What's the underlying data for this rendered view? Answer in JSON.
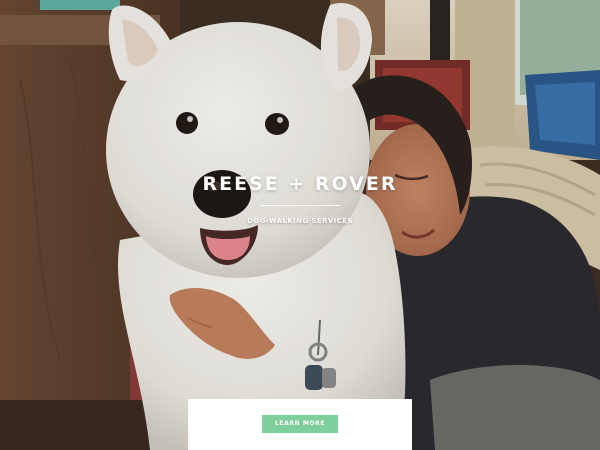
{
  "hero": {
    "title": "REESE + ROVER",
    "subtitle": "DOG-WALKING SERVICES",
    "photo_icon": "hero-photo-dog-and-owner"
  },
  "cta": {
    "label": "LEARN MORE",
    "color": "#7ecf9b"
  },
  "colors": {
    "text": "#ffffff",
    "panel": "#ffffff"
  }
}
